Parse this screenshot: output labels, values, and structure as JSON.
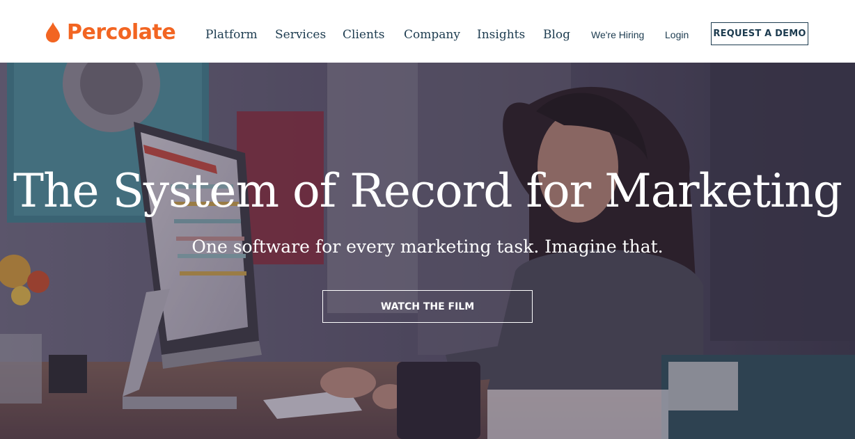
{
  "brand": {
    "name": "Percolate",
    "accent_color": "#f26522",
    "text_color": "#1c3b4f",
    "logo_icon": "drop-icon"
  },
  "nav": {
    "platform": "Platform",
    "services": "Services",
    "clients": "Clients",
    "company": "Company",
    "insights": "Insights",
    "blog": "Blog",
    "hiring": "We're Hiring",
    "login": "Login",
    "demo_button": "REQUEST A DEMO"
  },
  "hero": {
    "title": "The System of Record for Marketing",
    "subtitle": "One software for every marketing task. Imagine that.",
    "cta": "WATCH THE FILM"
  }
}
